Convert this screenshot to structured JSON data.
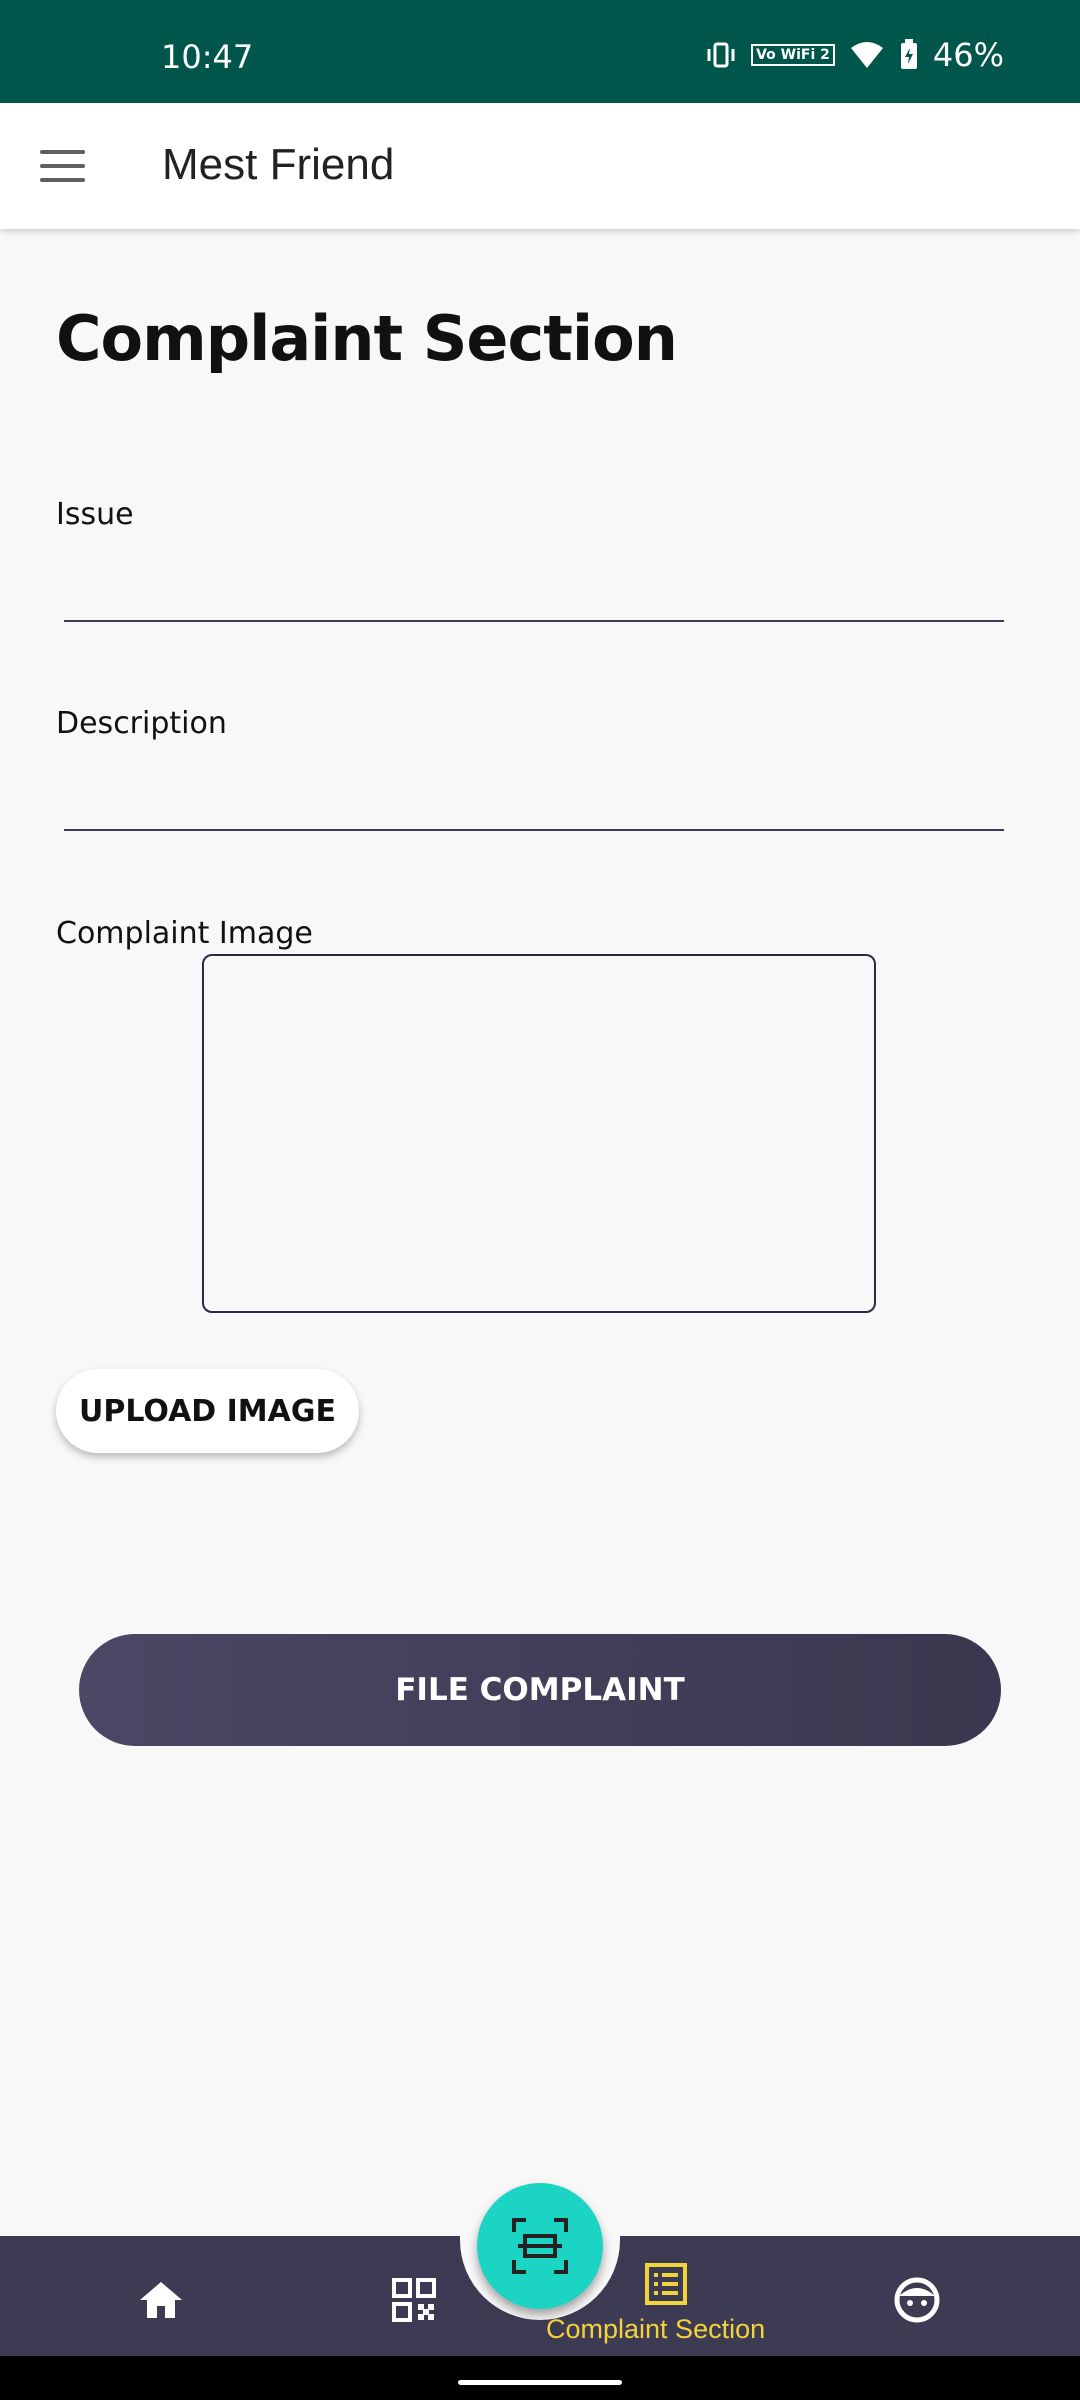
{
  "status_bar": {
    "time": "10:47",
    "volte_label": "Vo WiFi 2",
    "battery": "46%"
  },
  "app_bar": {
    "title": "Mest Friend"
  },
  "page": {
    "title": "Complaint Section"
  },
  "form": {
    "issue_label": "Issue",
    "issue_value": "",
    "description_label": "Description",
    "description_value": "",
    "image_label": "Complaint Image",
    "upload_label": "UPLOAD IMAGE",
    "submit_label": "FILE COMPLAINT"
  },
  "bottom_nav": {
    "items": [
      {
        "icon": "home-icon"
      },
      {
        "icon": "qr-code-icon"
      },
      {
        "icon": "scan-icon"
      },
      {
        "icon": "list-icon",
        "label": "Complaint Section",
        "active": true
      },
      {
        "icon": "face-icon"
      }
    ],
    "active_color": "#f2d43a",
    "fab_color": "#1bd4c3",
    "bar_color": "#3d3a53"
  }
}
